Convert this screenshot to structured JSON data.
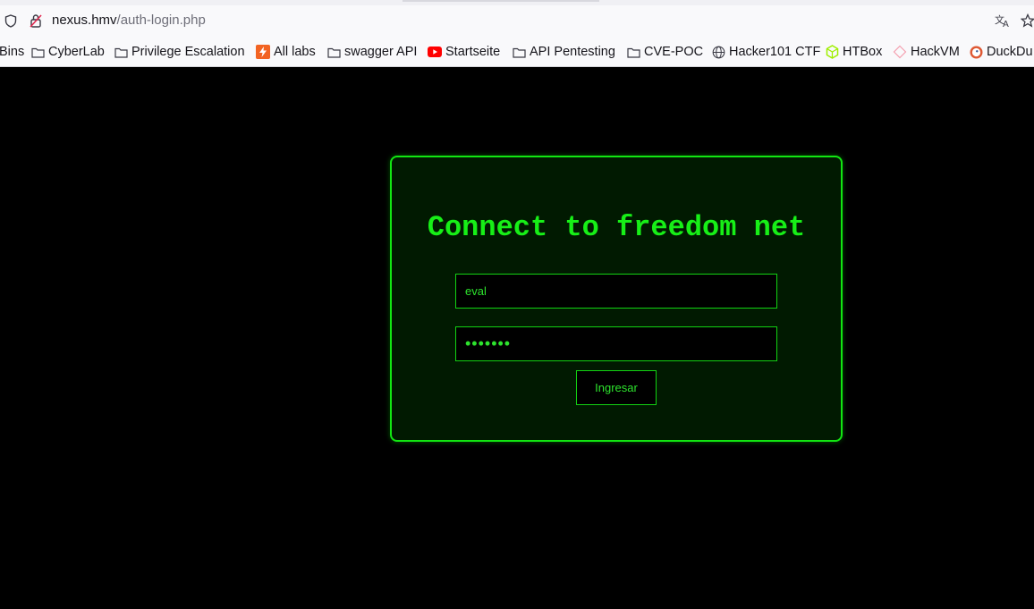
{
  "browser": {
    "url_host": "nexus.hmv",
    "url_path": "/auth-login.php",
    "bookmarks": [
      {
        "label": "Bins",
        "icon": "none"
      },
      {
        "label": "CyberLab",
        "icon": "folder-icon"
      },
      {
        "label": "Privilege Escalation",
        "icon": "folder-icon"
      },
      {
        "label": "All labs",
        "icon": "lightning-icon"
      },
      {
        "label": "swagger API",
        "icon": "folder-icon"
      },
      {
        "label": "Startseite",
        "icon": "youtube-icon"
      },
      {
        "label": "API Pentesting",
        "icon": "folder-icon"
      },
      {
        "label": "CVE-POC",
        "icon": "folder-icon"
      },
      {
        "label": "Hacker101 CTF",
        "icon": "globe-icon"
      },
      {
        "label": "HTBox",
        "icon": "cube-icon"
      },
      {
        "label": "HackVM",
        "icon": "diamond-icon"
      },
      {
        "label": "DuckDu",
        "icon": "duck-icon"
      }
    ]
  },
  "login": {
    "title": "Connect to freedom net",
    "username_value": "eval",
    "password_value": "•••••••",
    "submit_label": "Ingresar"
  },
  "colors": {
    "accent": "#12e612",
    "panel_bg": "#011a01",
    "page_bg": "#000000"
  }
}
